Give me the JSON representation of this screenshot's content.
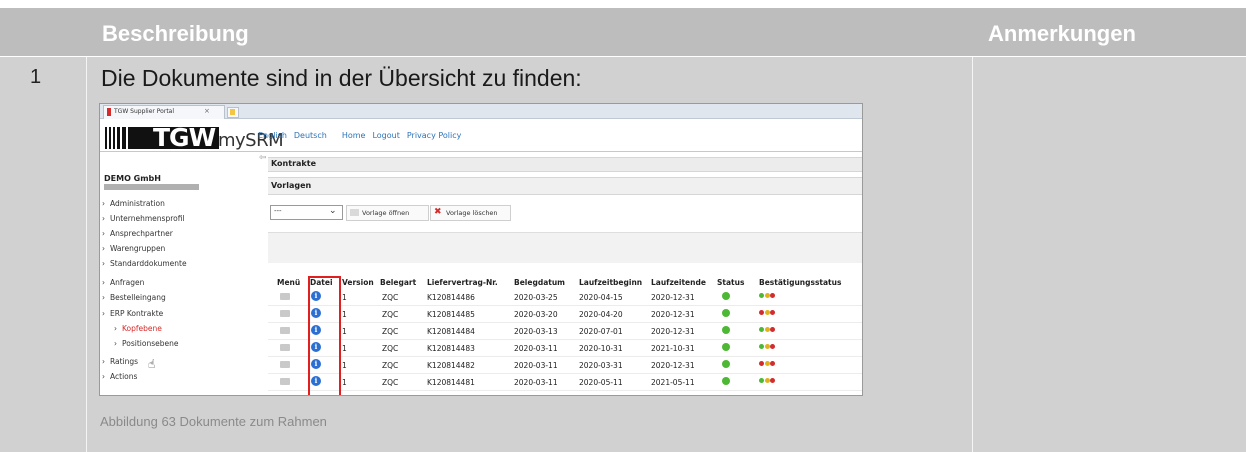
{
  "table": {
    "header_description": "Beschreibung",
    "header_notes": "Anmerkungen",
    "row_number": "1",
    "row_text": "Die Dokumente sind in der Übersicht zu finden:",
    "caption": "Abbildung 63 Dokumente zum Rahmen"
  },
  "screenshot": {
    "tab_title": "TGW Supplier Portal",
    "tab_close": "×",
    "logo_text": "TGW",
    "brand": "mySRM",
    "topnav": [
      "English",
      "Deutsch",
      "Home",
      "Logout",
      "Privacy Policy"
    ],
    "company_name": "DEMO GmbH",
    "sidebar": [
      {
        "label": "Administration"
      },
      {
        "label": "Unternehmensprofil"
      },
      {
        "label": "Ansprechpartner"
      },
      {
        "label": "Warengruppen"
      },
      {
        "label": "Standarddokumente"
      },
      {
        "label": "Anfragen"
      },
      {
        "label": "Bestelleingang"
      },
      {
        "label": "ERP Kontrakte"
      },
      {
        "label": "Kopfebene"
      },
      {
        "label": "Positionsebene"
      },
      {
        "label": "Ratings"
      },
      {
        "label": "Actions"
      }
    ],
    "panel_title": "Kontrakte",
    "templates_title": "Vorlagen",
    "select_value": "---",
    "open_template": "Vorlage öffnen",
    "delete_template": "Vorlage löschen",
    "columns": [
      "Menü",
      "Datei",
      "Version",
      "Belegart",
      "Liefervertrag-Nr.",
      "Belegdatum",
      "Laufzeitbeginn",
      "Laufzeitende",
      "Status",
      "Bestätigungsstatus"
    ],
    "rows": [
      {
        "version": "1",
        "type": "ZQC",
        "contract": "K120814486",
        "date": "2020-03-25",
        "start": "2020-04-15",
        "end": "2020-12-31",
        "confirmation": [
          "#4cb833",
          "#e0b31d",
          "#d32c2c"
        ]
      },
      {
        "version": "1",
        "type": "ZQC",
        "contract": "K120814485",
        "date": "2020-03-20",
        "start": "2020-04-20",
        "end": "2020-12-31",
        "confirmation": [
          "#d32c2c",
          "#e0b31d",
          "#d32c2c"
        ]
      },
      {
        "version": "1",
        "type": "ZQC",
        "contract": "K120814484",
        "date": "2020-03-13",
        "start": "2020-07-01",
        "end": "2020-12-31",
        "confirmation": [
          "#4cb833",
          "#e0b31d",
          "#d32c2c"
        ]
      },
      {
        "version": "1",
        "type": "ZQC",
        "contract": "K120814483",
        "date": "2020-03-11",
        "start": "2020-10-31",
        "end": "2021-10-31",
        "confirmation": [
          "#4cb833",
          "#e0b31d",
          "#d32c2c"
        ]
      },
      {
        "version": "1",
        "type": "ZQC",
        "contract": "K120814482",
        "date": "2020-03-11",
        "start": "2020-03-31",
        "end": "2020-12-31",
        "confirmation": [
          "#d32c2c",
          "#e0b31d",
          "#d32c2c"
        ]
      },
      {
        "version": "1",
        "type": "ZQC",
        "contract": "K120814481",
        "date": "2020-03-11",
        "start": "2020-05-11",
        "end": "2021-05-11",
        "confirmation": [
          "#4cb833",
          "#e0b31d",
          "#d32c2c"
        ]
      }
    ],
    "status_color": "#4cb833",
    "highlight_color": "#e02020",
    "link_color": "#2d74b8",
    "active_color": "#d72a2a"
  }
}
